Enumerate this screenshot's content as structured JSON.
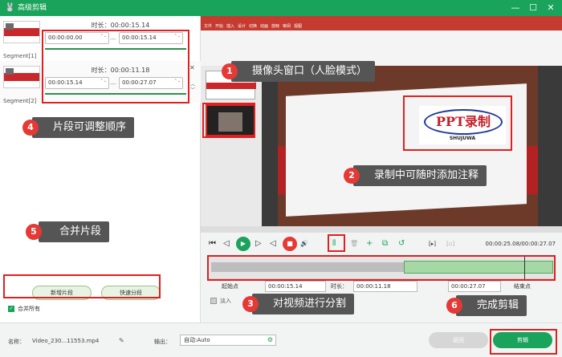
{
  "window": {
    "app_icon": "rabbit-icon",
    "title": "高级剪辑",
    "controls": [
      "minimize-icon",
      "maximize-icon",
      "close-icon"
    ],
    "minimize_glyph": "—",
    "maximize_glyph": "☐",
    "close_glyph": "✕"
  },
  "segments": [
    {
      "label": "Segment[1]",
      "duration": "时长：00:00:15.14",
      "start": "00:00:00.00",
      "end": "00:00:15.14"
    },
    {
      "label": "Segment[2]",
      "duration": "时长：00:00:11.18",
      "start": "00:00:15.14",
      "end": "00:00:27.07"
    }
  ],
  "segment_controls": {
    "close_glyph": "✕",
    "up_glyph": "︿",
    "down_glyph": "﹀",
    "spin_glyph": "⌃⌄",
    "dash": "—"
  },
  "left_actions": {
    "add_segment": "新增片段",
    "quick_split": "快速分段",
    "merge_all": "合并所有",
    "check_glyph": "✓"
  },
  "annotations": [
    {
      "num": "1",
      "text": "摄像头窗口（人脸模式）"
    },
    {
      "num": "2",
      "text": "录制中可随时添加注释"
    },
    {
      "num": "3",
      "text": "对视频进行分割"
    },
    {
      "num": "4",
      "text": "片段可调整顺序"
    },
    {
      "num": "5",
      "text": "合并片段"
    },
    {
      "num": "6",
      "text": "完成剪辑"
    }
  ],
  "preview": {
    "logo_text": "PPT录制",
    "logo_sub": "SHUJUWA",
    "ribbon_tabs": [
      "文件",
      "开始",
      "插入",
      "设计",
      "切换",
      "动画",
      "放映",
      "审阅",
      "视图"
    ]
  },
  "player": {
    "time_display": "00:00:25.08/00:00:27.07",
    "buttons": [
      "skip-start-icon",
      "step-back-icon",
      "play-icon",
      "step-forward-icon",
      "stop-icon",
      "volume-icon",
      "split-icon",
      "delete-icon",
      "add-icon",
      "copy-icon",
      "undo-icon",
      "crop-icon",
      "fit-icon"
    ],
    "glyphs": {
      "skip_start": "⏮",
      "step_back": "◁",
      "play": "▶",
      "step_forward": "▷",
      "stop": "■",
      "volume": "🔊",
      "split": "⫴",
      "delete": "🗑",
      "add": "+",
      "copy": "⧉",
      "undo": "↺",
      "crop": "[▸]",
      "fit": "[▫]"
    }
  },
  "split": {
    "start_label": "起始点",
    "start_value": "00:00:15.14",
    "duration_label": "时长：",
    "duration_value": "00:00:11.18",
    "end_value": "00:00:27.07",
    "end_label": "结束点",
    "fade_label": "淡入"
  },
  "bottom": {
    "name_label": "名称：",
    "name_value": "Video_230...11553.mp4",
    "edit_glyph": "✎",
    "output_label": "输出：",
    "output_value": "自动:Auto",
    "gear_glyph": "⚙",
    "return_label": "返回",
    "edit_label": "剪辑"
  },
  "colors": {
    "accent": "#1aa35a",
    "highlight": "#e02020",
    "callout_bg": "#555555"
  }
}
